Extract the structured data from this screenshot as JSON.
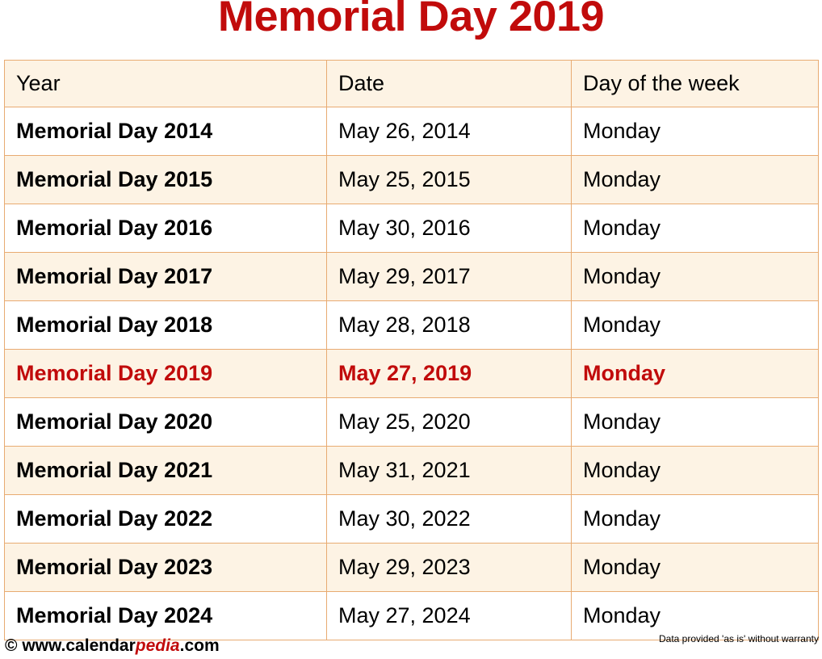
{
  "page": {
    "title": "Memorial Day 2019",
    "title_color": "#C10B0B",
    "background_color": "#FFFFFF"
  },
  "table": {
    "border_color": "#E8AB72",
    "row_alt_color": "#FDF3E4",
    "row_base_color": "#FFFFFF",
    "highlight_color": "#C10B0B",
    "headers": [
      "Year",
      "Date",
      "Day of the week"
    ],
    "rows": [
      {
        "year": "Memorial Day 2014",
        "date": "May 26, 2014",
        "day": "Monday",
        "shade": "white",
        "highlight": false
      },
      {
        "year": "Memorial Day 2015",
        "date": "May 25, 2015",
        "day": "Monday",
        "shade": "cream",
        "highlight": false
      },
      {
        "year": "Memorial Day 2016",
        "date": "May 30, 2016",
        "day": "Monday",
        "shade": "white",
        "highlight": false
      },
      {
        "year": "Memorial Day 2017",
        "date": "May 29, 2017",
        "day": "Monday",
        "shade": "cream",
        "highlight": false
      },
      {
        "year": "Memorial Day 2018",
        "date": "May 28, 2018",
        "day": "Monday",
        "shade": "white",
        "highlight": false
      },
      {
        "year": "Memorial Day 2019",
        "date": "May 27, 2019",
        "day": "Monday",
        "shade": "cream",
        "highlight": true
      },
      {
        "year": "Memorial Day 2020",
        "date": "May 25, 2020",
        "day": "Monday",
        "shade": "white",
        "highlight": false
      },
      {
        "year": "Memorial Day 2021",
        "date": "May 31, 2021",
        "day": "Monday",
        "shade": "cream",
        "highlight": false
      },
      {
        "year": "Memorial Day 2022",
        "date": "May 30, 2022",
        "day": "Monday",
        "shade": "white",
        "highlight": false
      },
      {
        "year": "Memorial Day 2023",
        "date": "May 29, 2023",
        "day": "Monday",
        "shade": "cream",
        "highlight": false
      },
      {
        "year": "Memorial Day 2024",
        "date": "May 27, 2024",
        "day": "Monday",
        "shade": "white",
        "highlight": false
      }
    ]
  },
  "footer": {
    "copyright_symbol": "©",
    "site_prefix": " www.calendar",
    "site_brand": "pedia",
    "site_suffix": ".com",
    "disclaimer": "Data provided 'as is' without warranty"
  }
}
